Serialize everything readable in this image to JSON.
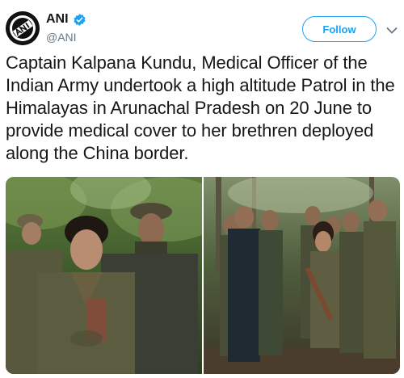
{
  "account": {
    "name": "ANI",
    "handle": "@ANI",
    "avatar_icon": "ani-logo-icon",
    "verified_icon": "verified-badge-icon",
    "verified_color": "#1da1f2"
  },
  "actions": {
    "follow_label": "Follow",
    "more_icon": "chevron-down-icon"
  },
  "tweet": {
    "text": "Captain Kalpana Kundu, Medical Officer of the Indian Army undertook a high altitude Patrol in the Himalayas in Arunachal Pradesh on 20 June to provide medical cover to her brethren deployed along the China border."
  },
  "media": [
    {
      "description_icon": "photo-officers-portrait"
    },
    {
      "description_icon": "photo-patrol-group"
    }
  ],
  "colors": {
    "accent": "#1da1f2",
    "text": "#14171a",
    "secondary": "#657786"
  }
}
